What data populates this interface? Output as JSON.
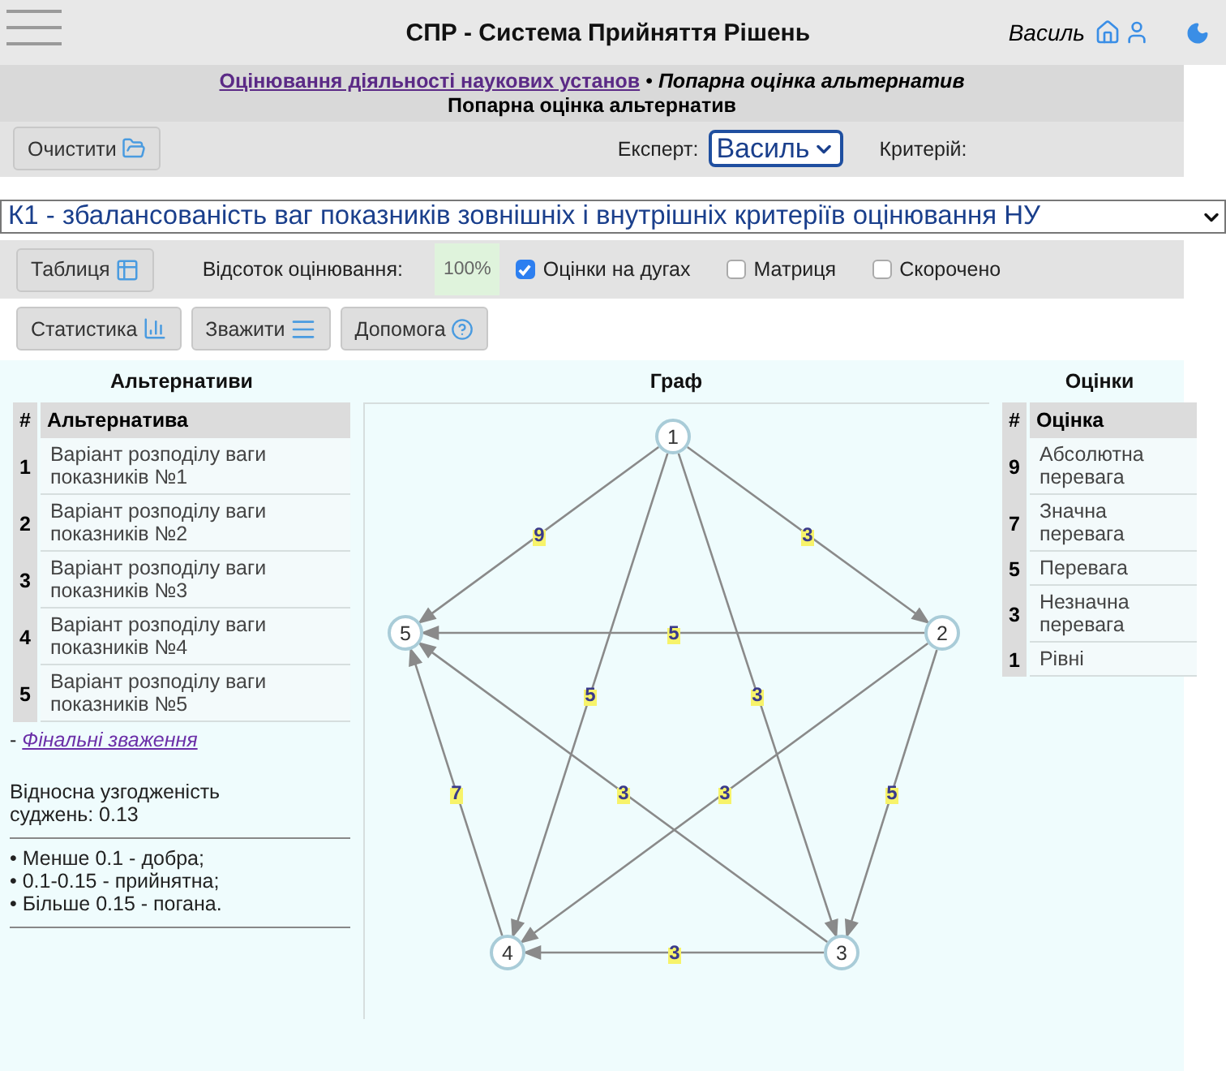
{
  "header": {
    "title": "СПР - Система Прийняття Рішень",
    "user": "Василь"
  },
  "breadcrumb": {
    "link": "Оцінювання діяльності наукових установ",
    "separator": "•",
    "current": "Попарна оцінка альтернатив",
    "subtitle": "Попарна оцінка альтернатив"
  },
  "toolbar": {
    "clear_button": "Очистити",
    "expert_label": "Експерт:",
    "expert_value": "Василь",
    "criterion_label": "Критерій:"
  },
  "criterion_select": {
    "value": "К1 - збалансованість ваг показників зовнішніх і внутрішніх критеріїв оцінювання НУ"
  },
  "options": {
    "table_button": "Таблиця",
    "percent_label": "Відсоток оцінювання:",
    "percent_value": "100%",
    "checkboxes": [
      {
        "label": "Оцінки на дугах",
        "checked": true
      },
      {
        "label": "Матриця",
        "checked": false
      },
      {
        "label": "Скорочено",
        "checked": false
      }
    ]
  },
  "buttons": [
    {
      "label": "Статистика",
      "kind": "stats"
    },
    {
      "label": "Зважити",
      "kind": "weigh"
    },
    {
      "label": "Допомога",
      "kind": "help"
    }
  ],
  "alternatives": {
    "title": "Альтернативи",
    "columns": [
      "#",
      "Альтернатива"
    ],
    "rows": [
      {
        "num": "1",
        "name": "Варіант розподілу ваги показників №1"
      },
      {
        "num": "2",
        "name": "Варіант розподілу ваги показників №2"
      },
      {
        "num": "3",
        "name": "Варіант розподілу ваги показників №3"
      },
      {
        "num": "4",
        "name": "Варіант розподілу ваги показників №4"
      },
      {
        "num": "5",
        "name": "Варіант розподілу ваги показників №5"
      }
    ],
    "final_prefix": "-",
    "final_link": "Фінальні зваження",
    "consistency": "Відносна узгодженість суджень: 0.13",
    "legend": [
      "• Менше 0.1 - добра;",
      "• 0.1-0.15 - прийнятна;",
      "• Більше 0.15 - погана."
    ]
  },
  "graph": {
    "title": "Граф",
    "nodes": [
      "1",
      "2",
      "3",
      "4",
      "5"
    ],
    "edges": [
      {
        "label": "9"
      },
      {
        "label": "3"
      },
      {
        "label": "5"
      },
      {
        "label": "5"
      },
      {
        "label": "3"
      },
      {
        "label": "7"
      },
      {
        "label": "3"
      },
      {
        "label": "3"
      },
      {
        "label": "5"
      },
      {
        "label": "3"
      }
    ]
  },
  "scores": {
    "title": "Оцінки",
    "columns": [
      "#",
      "Оцінка"
    ],
    "rows": [
      {
        "num": "9",
        "name": "Абсолютна перевага"
      },
      {
        "num": "7",
        "name": "Значна перевага"
      },
      {
        "num": "5",
        "name": "Перевага"
      },
      {
        "num": "3",
        "name": "Незначна перевага"
      },
      {
        "num": "1",
        "name": "Рівні"
      }
    ]
  }
}
